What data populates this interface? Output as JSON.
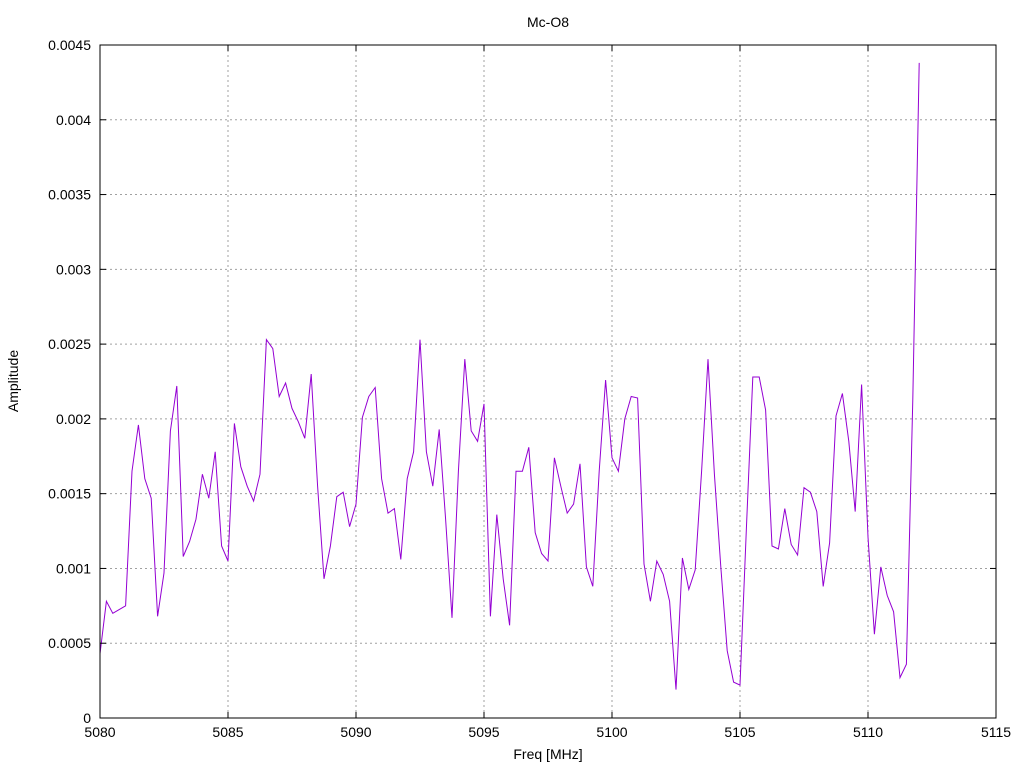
{
  "chart_data": {
    "type": "line",
    "title": "Mc-O8",
    "xlabel": "Freq [MHz]",
    "ylabel": "Amplitude",
    "xlim": [
      5080,
      5115
    ],
    "ylim": [
      0,
      0.0045
    ],
    "xticks": [
      5080,
      5085,
      5090,
      5095,
      5100,
      5105,
      5110,
      5115
    ],
    "xtick_labels": [
      "5080",
      "5085",
      "5090",
      "5095",
      "5100",
      "5105",
      "5110",
      "5115"
    ],
    "yticks": [
      0,
      0.0005,
      0.001,
      0.0015,
      0.002,
      0.0025,
      0.003,
      0.0035,
      0.004,
      0.0045
    ],
    "ytick_labels": [
      "0",
      "0.0005",
      "0.001",
      "0.0015",
      "0.002",
      "0.0025",
      "0.003",
      "0.0035",
      "0.004",
      "0.0045"
    ],
    "grid": true,
    "series": [
      {
        "color": "#9400d3",
        "x": [
          5080,
          5080.25,
          5080.5,
          5081,
          5081.25,
          5081.5,
          5081.75,
          5082,
          5082.25,
          5082.5,
          5082.75,
          5083,
          5083.25,
          5083.5,
          5083.75,
          5084,
          5084.25,
          5084.5,
          5084.75,
          5085,
          5085.25,
          5085.5,
          5085.75,
          5086,
          5086.25,
          5086.5,
          5086.75,
          5087,
          5087.25,
          5087.5,
          5087.75,
          5088,
          5088.25,
          5088.5,
          5088.75,
          5089,
          5089.25,
          5089.5,
          5089.75,
          5090,
          5090.25,
          5090.5,
          5090.75,
          5091,
          5091.25,
          5091.5,
          5091.75,
          5092,
          5092.25,
          5092.5,
          5092.75,
          5093,
          5093.25,
          5093.5,
          5093.75,
          5094,
          5094.25,
          5094.5,
          5094.75,
          5095,
          5095.25,
          5095.5,
          5095.75,
          5096,
          5096.25,
          5096.5,
          5096.75,
          5097,
          5097.25,
          5097.5,
          5097.75,
          5098,
          5098.25,
          5098.5,
          5098.75,
          5099,
          5099.25,
          5099.5,
          5099.75,
          5100,
          5100.25,
          5100.5,
          5100.75,
          5101,
          5101.25,
          5101.5,
          5101.75,
          5102,
          5102.25,
          5102.5,
          5102.75,
          5103,
          5103.25,
          5103.5,
          5103.75,
          5104,
          5104.25,
          5104.5,
          5104.75,
          5105,
          5105.25,
          5105.5,
          5105.75,
          5106,
          5106.25,
          5106.5,
          5106.75,
          5107,
          5107.25,
          5107.5,
          5107.75,
          5108,
          5108.25,
          5108.5,
          5108.75,
          5109,
          5109.25,
          5109.5,
          5109.75,
          5110,
          5110.25,
          5110.5,
          5110.75,
          5111,
          5111.25,
          5111.5,
          5111.75,
          5112
        ],
        "y": [
          0.00043,
          0.00078,
          0.0007,
          0.00075,
          0.00165,
          0.00196,
          0.0016,
          0.00147,
          0.00068,
          0.00097,
          0.00192,
          0.00222,
          0.00108,
          0.00118,
          0.00133,
          0.00163,
          0.00147,
          0.00178,
          0.00115,
          0.00105,
          0.00197,
          0.00168,
          0.00155,
          0.00145,
          0.00163,
          0.00253,
          0.00247,
          0.00215,
          0.00224,
          0.00207,
          0.00198,
          0.00187,
          0.0023,
          0.00155,
          0.00093,
          0.00115,
          0.00148,
          0.00151,
          0.00128,
          0.00143,
          0.00201,
          0.00215,
          0.00221,
          0.0016,
          0.00137,
          0.0014,
          0.00106,
          0.0016,
          0.00178,
          0.00253,
          0.00178,
          0.00155,
          0.00193,
          0.00133,
          0.00067,
          0.00165,
          0.0024,
          0.00192,
          0.00185,
          0.0021,
          0.00068,
          0.00136,
          0.00093,
          0.00062,
          0.00165,
          0.00165,
          0.00181,
          0.00124,
          0.0011,
          0.00105,
          0.00174,
          0.00155,
          0.00137,
          0.00143,
          0.0017,
          0.00101,
          0.00088,
          0.00165,
          0.00226,
          0.00174,
          0.00165,
          0.002,
          0.00215,
          0.00214,
          0.00103,
          0.00078,
          0.00105,
          0.00096,
          0.00078,
          0.00019,
          0.00107,
          0.00086,
          0.00099,
          0.00165,
          0.0024,
          0.00163,
          0.00101,
          0.00045,
          0.00024,
          0.00022,
          0.00127,
          0.00228,
          0.00228,
          0.00206,
          0.00115,
          0.00113,
          0.0014,
          0.00116,
          0.00109,
          0.00154,
          0.00151,
          0.00138,
          0.00088,
          0.00117,
          0.00202,
          0.00217,
          0.00185,
          0.00138,
          0.00223,
          0.00121,
          0.00056,
          0.00101,
          0.00082,
          0.00071,
          0.00027,
          0.00036,
          0.00213,
          0.00438
        ]
      }
    ]
  },
  "colors": {
    "grid": "#a0a0a0",
    "axis": "#000000"
  }
}
